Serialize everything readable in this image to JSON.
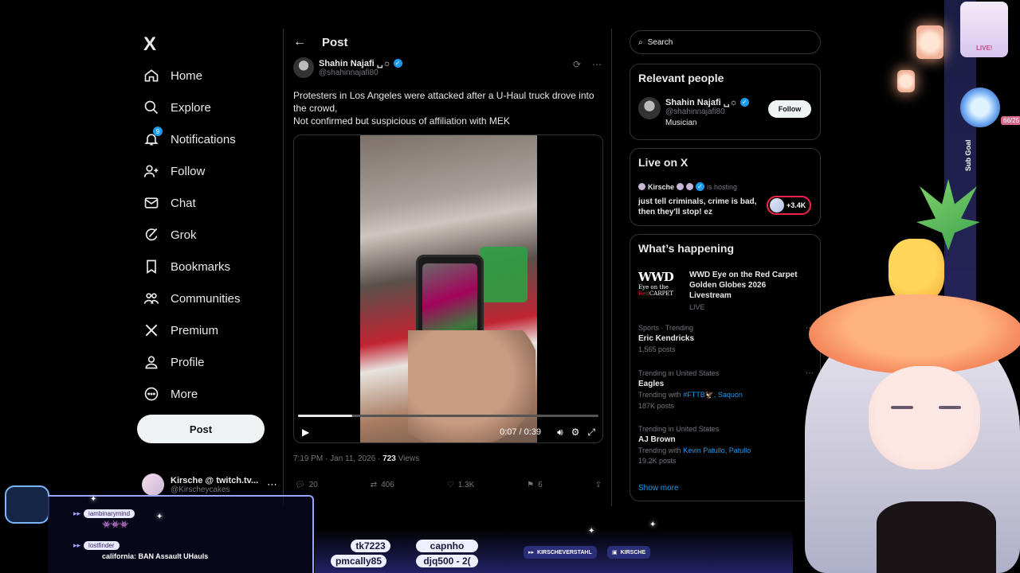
{
  "nav": {
    "logo": "X",
    "items": [
      {
        "label": "Home",
        "icon": "home-icon"
      },
      {
        "label": "Explore",
        "icon": "search-icon"
      },
      {
        "label": "Notifications",
        "icon": "bell-icon",
        "badge": "9"
      },
      {
        "label": "Follow",
        "icon": "person-add-icon"
      },
      {
        "label": "Chat",
        "icon": "mail-icon"
      },
      {
        "label": "Grok",
        "icon": "grok-icon"
      },
      {
        "label": "Bookmarks",
        "icon": "bookmark-icon"
      },
      {
        "label": "Communities",
        "icon": "people-icon"
      },
      {
        "label": "Premium",
        "icon": "x-logo-icon"
      },
      {
        "label": "Profile",
        "icon": "person-icon"
      },
      {
        "label": "More",
        "icon": "more-circle-icon"
      }
    ],
    "post_label": "Post",
    "account": {
      "name": "Kirsche @ twitch.tv...",
      "handle": "@Kirscheycakes",
      "more": "⋯"
    }
  },
  "post": {
    "header_title": "Post",
    "author_name": "Shahin Najafi ␣☼",
    "author_handle": "@shahinnajafi80",
    "text_lines": [
      "Protesters in Los Angeles were attacked after a U-Haul truck drove into the crowd,",
      "Not confirmed but suspicious of affiliation with MEK"
    ],
    "video": {
      "time": "0:07 / 0:39",
      "progress": 0.18
    },
    "time": "7:19 PM · Jan 11, 2026 · ",
    "views_count": "723",
    "views_label": " Views",
    "replies": "20",
    "reposts": "406",
    "likes": "1.3K",
    "bookmarks": "6"
  },
  "sidebar": {
    "search_placeholder": "Search",
    "relevant": {
      "title": "Relevant people",
      "name": "Shahin Najafi ␣☼",
      "handle": "@shahinnajafi80",
      "bio": "Musician",
      "follow_label": "Follow"
    },
    "live": {
      "title": "Live on X",
      "host": "Kirsche",
      "host_suffix": "is hosting",
      "stream_title": "just tell criminals, crime is bad, then they'll stop! ez",
      "listeners": "+3.4K"
    },
    "happening": {
      "title": "What’s happening",
      "feature": {
        "title": "WWD Eye on the Red Carpet Golden Globes 2026 Livestream",
        "status": "LIVE",
        "logo_top": "WWD",
        "logo_mid": "Eye on the",
        "logo_red": "Red",
        "logo_bottom": "CARPET"
      },
      "trends": [
        {
          "context": "Sports · Trending",
          "title": "Eric Kendricks",
          "count": "1,565 posts",
          "with": "",
          "links": ""
        },
        {
          "context": "Trending in United States",
          "title": "Eagles",
          "count": "187K posts",
          "with": "Trending with ",
          "links": "#FTTB🦅, Saquon"
        },
        {
          "context": "Trending in United States",
          "title": "AJ Brown",
          "count": "19.2K posts",
          "with": "Trending with ",
          "links": "Kevin Patullo, Patullo"
        }
      ],
      "show_more": "Show more"
    }
  },
  "overlay": {
    "sub_goal": "Sub Goal",
    "goal_count": "66/25",
    "chat": [
      {
        "user": "iambinarymind",
        "msg": "👾👾👾"
      },
      {
        "user": "lostfinder",
        "msg": "california: BAN Assault UHauls"
      }
    ],
    "tickers": [
      "tk7223",
      "capnho",
      "pmcally85",
      "djq500 - 2("
    ],
    "socials": [
      "KIRSCHEVERSTAHL",
      "KIRSCHE"
    ],
    "live_badge": "LIVE!"
  }
}
